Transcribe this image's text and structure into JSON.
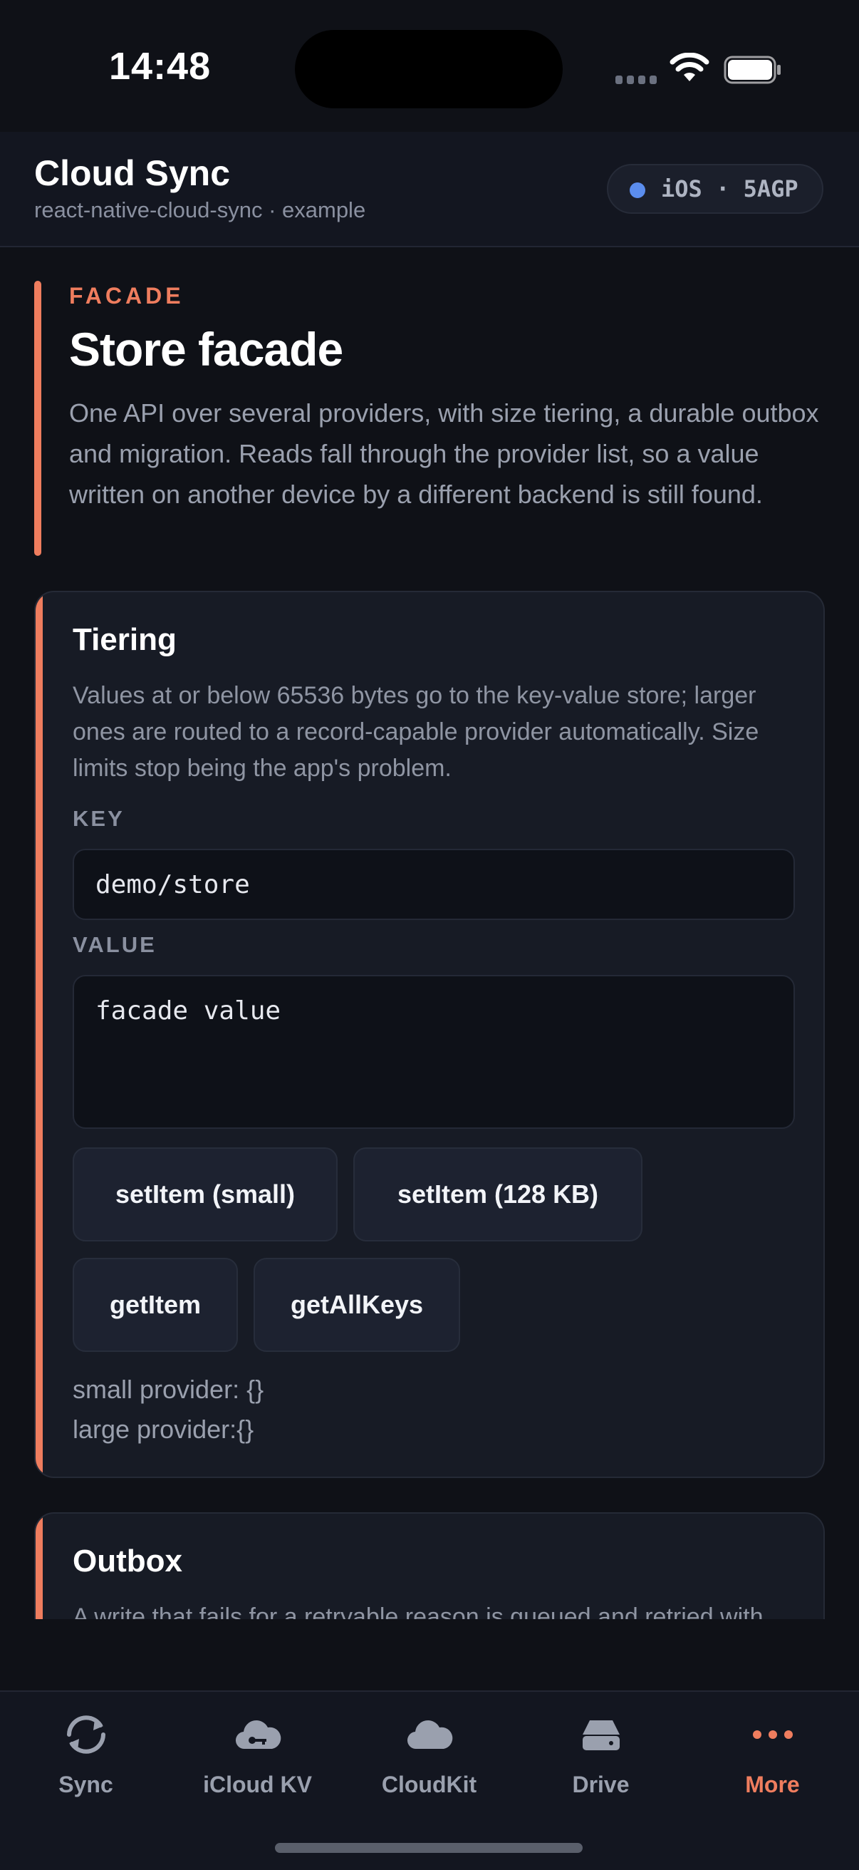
{
  "status_bar": {
    "time": "14:48"
  },
  "header": {
    "title": "Cloud Sync",
    "subtitle": "react-native-cloud-sync · example",
    "platform_badge": "iOS · 5AGP"
  },
  "hero": {
    "eyebrow": "FACADE",
    "title": "Store facade",
    "description": "One API over several providers, with size tiering, a durable outbox and migration. Reads fall through the provider list, so a value written on another device by a different backend is still found."
  },
  "tiering_card": {
    "title": "Tiering",
    "description": "Values at or below 65536 bytes go to the key-value store; larger ones are routed to a record-capable provider automatically. Size limits stop being the app's problem.",
    "key_label": "KEY",
    "key_value": "demo/store",
    "value_label": "VALUE",
    "value_value": "facade value",
    "buttons": {
      "set_small": "setItem (small)",
      "set_large": "setItem (128 KB)",
      "get_item": "getItem",
      "get_all_keys": "getAllKeys"
    },
    "small_provider": "small provider: {}",
    "large_provider": "large provider:{}"
  },
  "outbox_card": {
    "title": "Outbox",
    "description": "A write that fails for a retryable reason is queued and retried with backoff, rather than being lost. Failures the user must act on - quota exceeded, signed out - are"
  },
  "tabs": [
    {
      "label": "Sync",
      "icon": "sync-icon"
    },
    {
      "label": "iCloud KV",
      "icon": "cloud-key-icon"
    },
    {
      "label": "CloudKit",
      "icon": "cloud-icon"
    },
    {
      "label": "Drive",
      "icon": "drive-icon"
    },
    {
      "label": "More",
      "icon": "more-dots-icon",
      "active": true
    }
  ],
  "colors": {
    "accent": "#ef7d5e",
    "background": "#0f1117",
    "card": "#171b25",
    "platform_dot": "#5b8dee"
  }
}
